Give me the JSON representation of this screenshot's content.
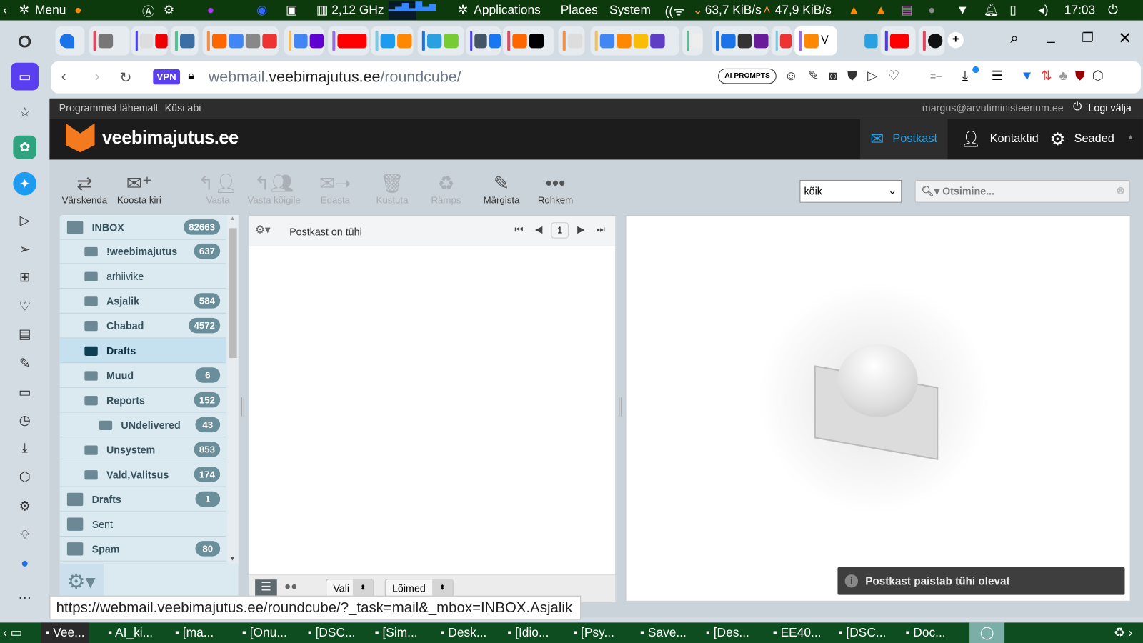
{
  "system_panel": {
    "menu": "Menu",
    "cpu": "2,12 GHz",
    "applications": "Applications",
    "places": "Places",
    "system": "System",
    "net_down": "63,7 KiB/s",
    "net_up": "47,9 KiB/s",
    "clock": "17:03"
  },
  "browser": {
    "vpn": "VPN",
    "url_host_prefix": "webmail.",
    "url_host": "veebimajutus.ee",
    "url_path": "/roundcube/",
    "ai_prompts": "AI PROMPTS",
    "status_url": "https://webmail.veebimajutus.ee/roundcube/?_task=mail&_mbox=INBOX.Asjalik"
  },
  "roundcube": {
    "top_links": [
      "Programmist lähemalt",
      "Küsi abi"
    ],
    "user": "margus@arvutiministeerium.ee",
    "logout": "Logi välja",
    "logo": "veebimajutus.ee",
    "nav": [
      "Postkast",
      "Kontaktid",
      "Seaded"
    ],
    "toolbar": [
      "Värskenda",
      "Koosta kiri",
      "Vasta",
      "Vasta kõigile",
      "Edasta",
      "Kustuta",
      "Rämps",
      "Märgista",
      "Rohkem"
    ],
    "filter": "kõik",
    "search_placeholder": "Otsimine...",
    "folders": [
      {
        "name": "INBOX",
        "count": "82663"
      },
      {
        "name": "!weebimajutus",
        "count": "637"
      },
      {
        "name": "arhiivike",
        "count": ""
      },
      {
        "name": "Asjalik",
        "count": "584"
      },
      {
        "name": "Chabad",
        "count": "4572"
      },
      {
        "name": "Drafts",
        "count": ""
      },
      {
        "name": "Muud",
        "count": "6"
      },
      {
        "name": "Reports",
        "count": "152"
      },
      {
        "name": "UNdelivered",
        "count": "43"
      },
      {
        "name": "Unsystem",
        "count": "853"
      },
      {
        "name": "Vald,Valitsus",
        "count": "174"
      },
      {
        "name": "Drafts",
        "count": "1"
      },
      {
        "name": "Sent",
        "count": ""
      },
      {
        "name": "Spam",
        "count": "80"
      }
    ],
    "list_status": "Postkast on tühi",
    "page": "1",
    "select_label": "Vali",
    "threads_label": "Lõimed",
    "toast": "Postkast paistab tühi olevat"
  },
  "taskbar": [
    "Vee...",
    "AI_ki...",
    "[ma...",
    "[Onu...",
    "[DSC...",
    "[Sim...",
    "Desk...",
    "[Idio...",
    "[Psy...",
    "Save...",
    "[Des...",
    "EE40...",
    "[DSC...",
    "Doc..."
  ]
}
